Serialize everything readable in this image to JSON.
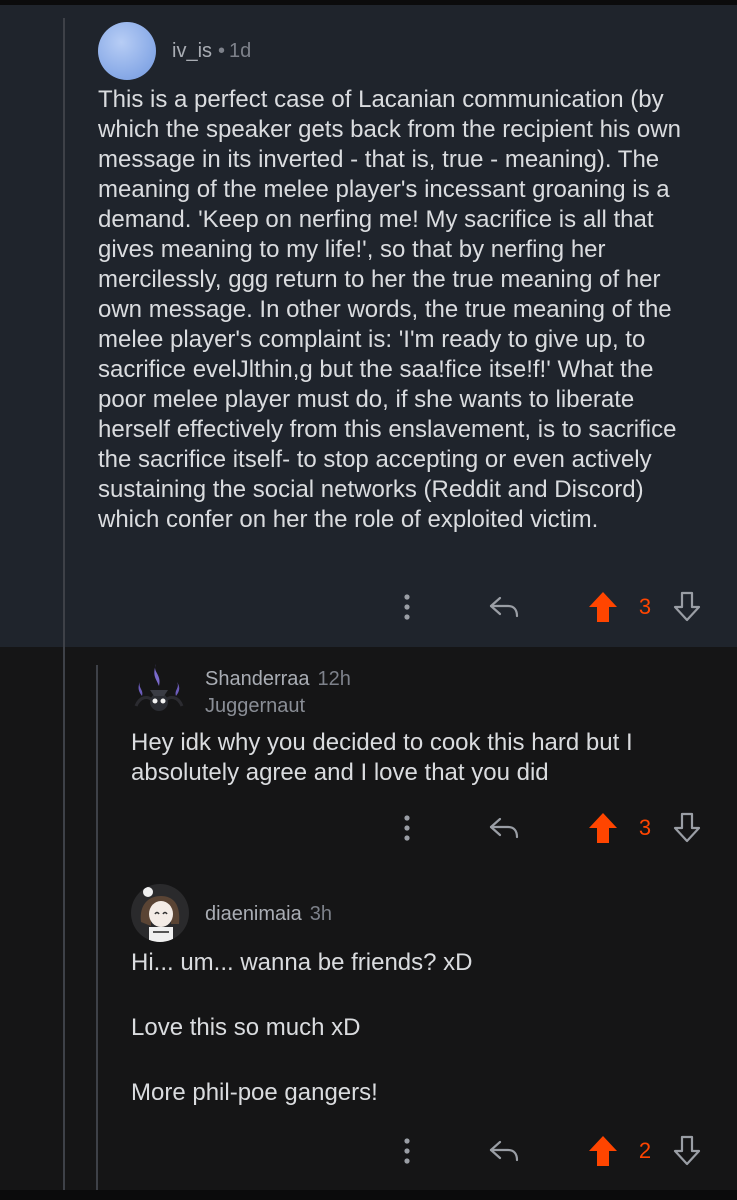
{
  "comments": [
    {
      "username": "iv_is",
      "time": "1d",
      "separator": "•",
      "text": "This is a perfect case of Lacanian communication (by which the speaker gets back from the recipient his own message in its inverted - that is, true - meaning). The meaning of the melee player's incessant groaning is a demand. 'Keep on nerfing me! My sacrifice is all that gives meaning to my life!', so that by nerfing her mercilessly, ggg return to her the true meaning of her own message. In other words, the true meaning of the melee player's complaint is: 'I'm ready to give up, to sacrifice evelJlthin,g but the saa!fice itse!f!' What the poor melee player must do, if she wants to liberate herself effectively from this enslavement, is to sacrifice the sacrifice itself- to stop accepting or even actively sustaining the social networks (Reddit and Discord) which confer on her the role of exploited victim.",
      "score": "3",
      "highlighted": true
    },
    {
      "username": "Shanderraa",
      "time": "12h",
      "flair": "Juggernaut",
      "text": "Hey idk why you decided to cook this hard but I absolutely agree and I love that you did",
      "score": "3"
    },
    {
      "username": "diaenimaia",
      "time": "3h",
      "paragraphs": [
        "Hi... um... wanna be friends? xD",
        "Love this so much xD",
        "More phil-poe gangers!"
      ],
      "score": "2"
    }
  ],
  "icons": {
    "more": "more-vertical-icon",
    "reply": "reply-arrow-icon",
    "upvote": "upvote-arrow-icon",
    "downvote": "downvote-arrow-icon"
  },
  "colors": {
    "upvote_active": "#ff4500",
    "highlight_bg": "#1f242c",
    "page_bg": "#151516",
    "text": "#dadcdf",
    "meta": "#a9adb4"
  }
}
